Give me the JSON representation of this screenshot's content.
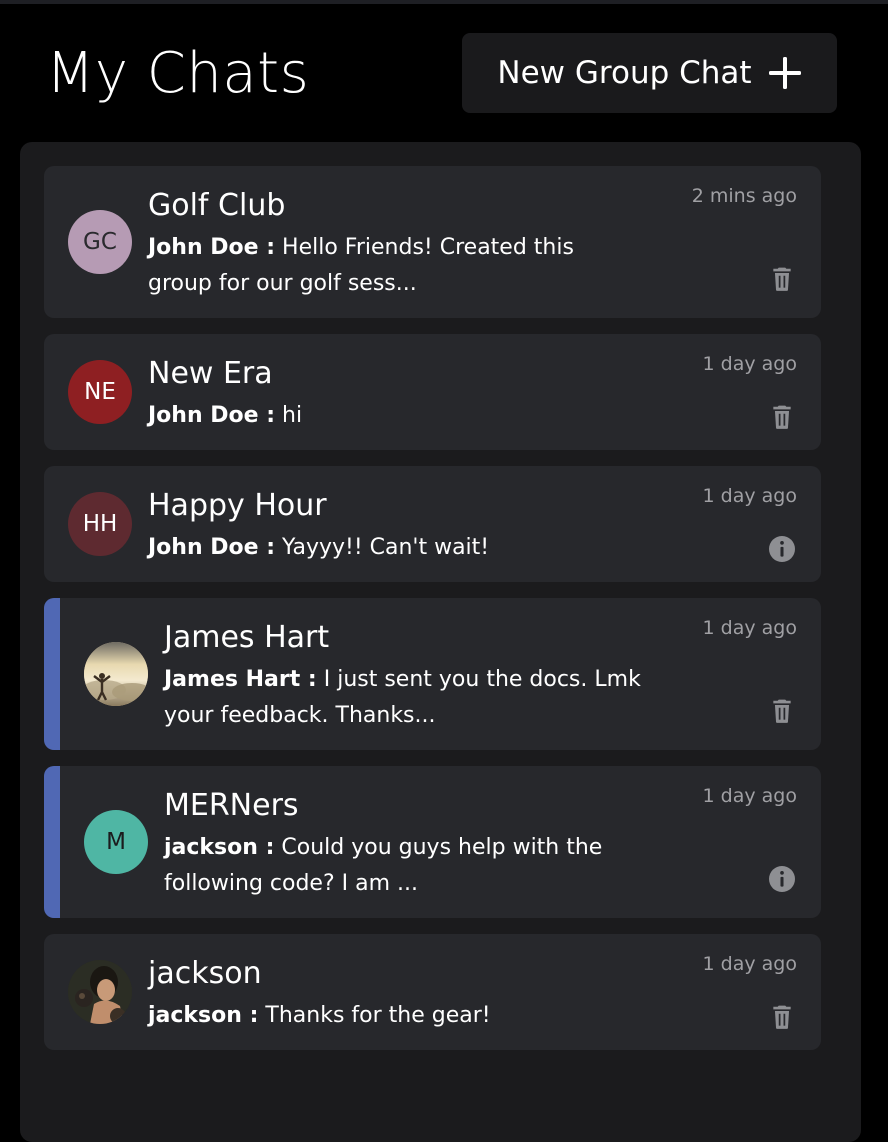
{
  "header": {
    "title": "My Chats",
    "new_group_label": "New Group Chat",
    "new_group_icon": "plus-icon"
  },
  "chats": [
    {
      "name": "Golf Club",
      "avatar_initials": "GC",
      "avatar_color": "#b69bb4",
      "avatar_text_color": "#2a2a2e",
      "sender": "John Doe :",
      "preview": "Hello Friends! Created this group for our golf sess...",
      "time": "2 mins ago",
      "action_icon": "trash-icon",
      "unread": false
    },
    {
      "name": "New Era",
      "avatar_initials": "NE",
      "avatar_color": "#8e1f22",
      "avatar_text_color": "#ffffff",
      "sender": "John Doe :",
      "preview": "hi",
      "time": "1 day ago",
      "action_icon": "trash-icon",
      "unread": false
    },
    {
      "name": "Happy Hour",
      "avatar_initials": "HH",
      "avatar_color": "#5e2a30",
      "avatar_text_color": "#ffffff",
      "sender": "John Doe :",
      "preview": "Yayyy!! Can't wait!",
      "time": "1 day ago",
      "action_icon": "info-icon",
      "unread": false
    },
    {
      "name": "James Hart",
      "avatar_initials": "",
      "avatar_color": "#c9b188",
      "avatar_text_color": "#ffffff",
      "avatar_icon": "user-photo-sky-avatar",
      "sender": "James Hart :",
      "preview": "I just sent you the docs. Lmk your feedback. Thanks...",
      "time": "1 day ago",
      "action_icon": "trash-icon",
      "unread": true
    },
    {
      "name": "MERNers",
      "avatar_initials": "M",
      "avatar_color": "#4fb6a4",
      "avatar_text_color": "#1b1b1d",
      "sender": "jackson :",
      "preview": "Could you guys help with the following code? I am ...",
      "time": "1 day ago",
      "action_icon": "info-icon",
      "unread": true
    },
    {
      "name": "jackson",
      "avatar_initials": "",
      "avatar_color": "#2b2d24",
      "avatar_text_color": "#ffffff",
      "avatar_icon": "user-photo-boxer-avatar",
      "sender": "jackson :",
      "preview": "Thanks for the gear!",
      "time": "1 day ago",
      "action_icon": "trash-icon",
      "unread": false
    }
  ],
  "colors": {
    "background": "#000000",
    "panel": "#1b1b1d",
    "card": "#27282c",
    "unread_accent": "#5068b4",
    "muted_text": "#a0a0a4",
    "icon": "#8e8f93"
  }
}
